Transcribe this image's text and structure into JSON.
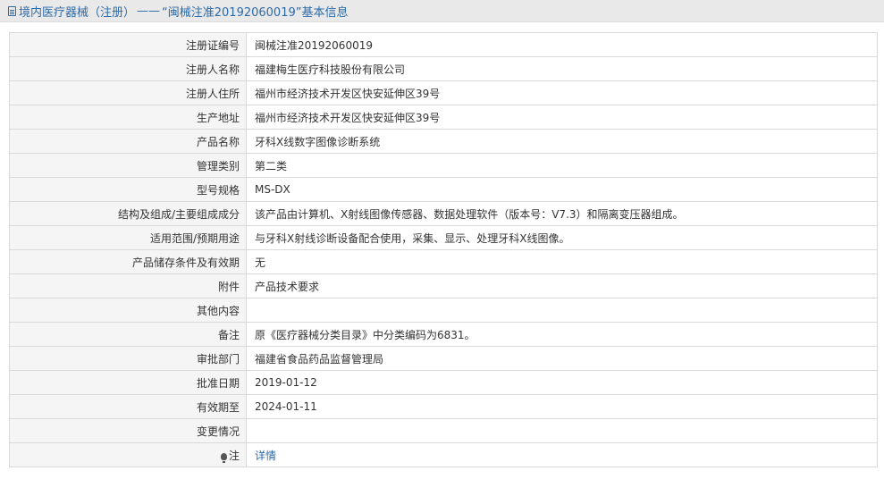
{
  "header": {
    "category": "境内医疗器械（注册）",
    "dash": "——",
    "title": "“闽械注准20192060019”基本信息",
    "icon": "document-icon"
  },
  "rows": [
    {
      "label": "注册证编号",
      "value": "闽械注准20192060019"
    },
    {
      "label": "注册人名称",
      "value": "福建梅生医疗科技股份有限公司"
    },
    {
      "label": "注册人住所",
      "value": "福州市经济技术开发区快安延伸区39号"
    },
    {
      "label": "生产地址",
      "value": "福州市经济技术开发区快安延伸区39号"
    },
    {
      "label": "产品名称",
      "value": "牙科X线数字图像诊断系统"
    },
    {
      "label": "管理类别",
      "value": "第二类"
    },
    {
      "label": "型号规格",
      "value": "MS-DX"
    },
    {
      "label": "结构及组成/主要组成成分",
      "value": "该产品由计算机、X射线图像传感器、数据处理软件（版本号：V7.3）和隔离变压器组成。"
    },
    {
      "label": "适用范围/预期用途",
      "value": "与牙科X射线诊断设备配合使用，采集、显示、处理牙科X线图像。"
    },
    {
      "label": "产品储存条件及有效期",
      "value": "无"
    },
    {
      "label": "附件",
      "value": "产品技术要求"
    },
    {
      "label": "其他内容",
      "value": ""
    },
    {
      "label": "备注",
      "value": "原《医疗器械分类目录》中分类编码为6831。"
    },
    {
      "label": "审批部门",
      "value": "福建省食品药品监督管理局"
    },
    {
      "label": "批准日期",
      "value": "2019-01-12"
    },
    {
      "label": "有效期至",
      "value": "2024-01-11"
    },
    {
      "label": "变更情况",
      "value": ""
    }
  ],
  "note_row": {
    "icon": "lightbulb-icon",
    "label": "注",
    "link_text": "详情",
    "link_color": "#2d6aa8"
  }
}
